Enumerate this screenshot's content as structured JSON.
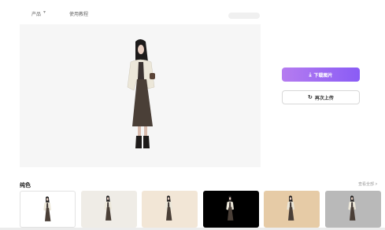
{
  "nav": {
    "product_label": "产品",
    "chevron": "▾",
    "tutorial_label": "使用教程"
  },
  "actions": {
    "download_label": "下载图片",
    "download_icon": "download-icon",
    "reupload_label": "再次上传",
    "reupload_icon": "refresh-icon"
  },
  "backgrounds": {
    "title": "纯色",
    "view_all": "查看全部 >",
    "swatches": [
      {
        "color": "#ffffff"
      },
      {
        "color": "#efece6"
      },
      {
        "color": "#f2e6d6"
      },
      {
        "color": "#000000"
      },
      {
        "color": "#e6cba6"
      },
      {
        "color": "#b9b9b9"
      }
    ]
  },
  "colors": {
    "accent_start": "#b57cf0",
    "accent_end": "#8a5cf5",
    "stage_bg": "#f6f6f6"
  }
}
